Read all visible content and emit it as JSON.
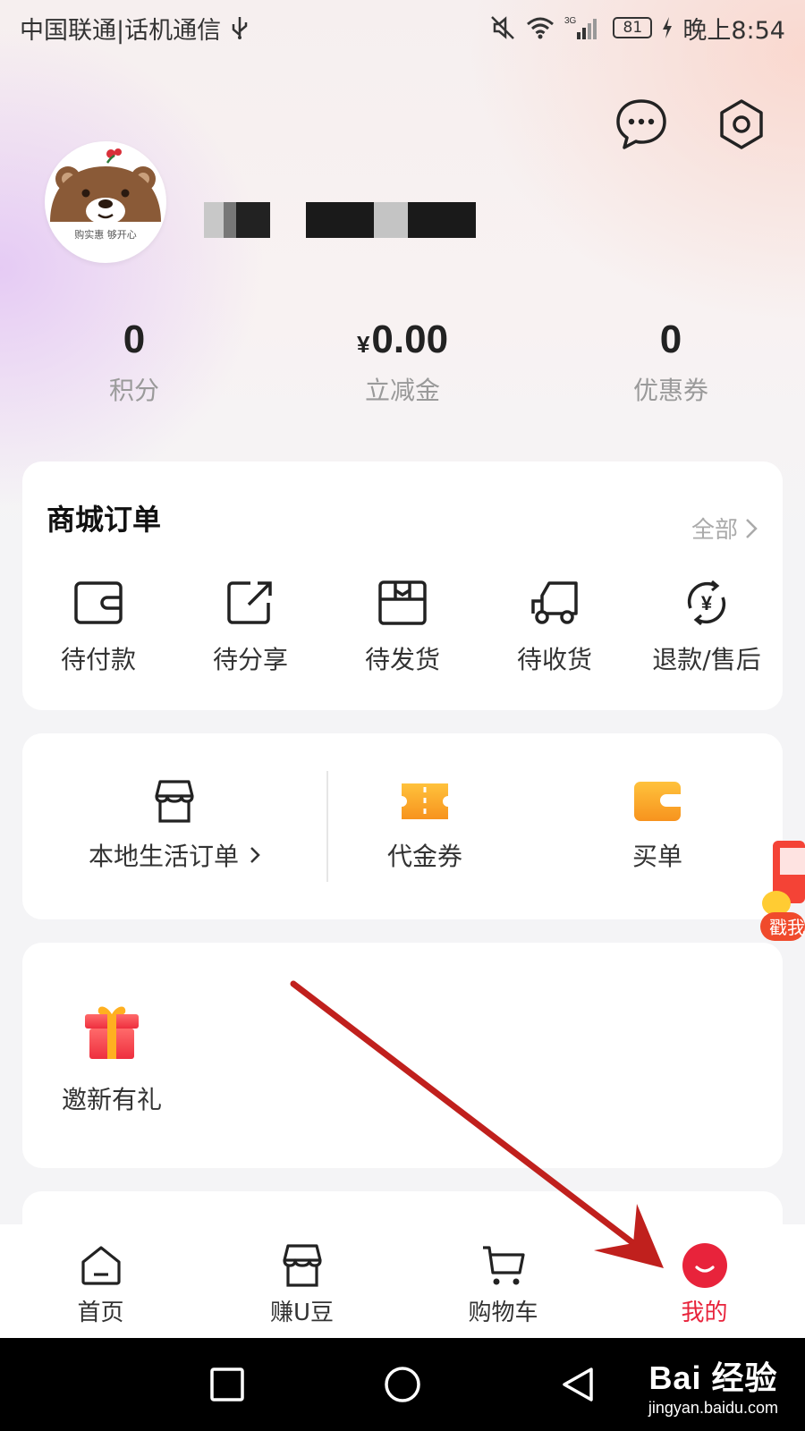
{
  "status_bar": {
    "carrier": "中国联通|话机通信",
    "battery": "81",
    "time": "晚上8:54",
    "network": "3G"
  },
  "profile": {
    "avatar_text": "购实惠 够开心",
    "username": "■■ ■■■■"
  },
  "stats": [
    {
      "value": "0",
      "label": "积分"
    },
    {
      "currency": "¥",
      "value": "0.00",
      "label": "立减金"
    },
    {
      "value": "0",
      "label": "优惠券"
    }
  ],
  "orders": {
    "title": "商城订单",
    "more": "全部",
    "items": [
      {
        "label": "待付款",
        "icon": "wallet-icon"
      },
      {
        "label": "待分享",
        "icon": "share-icon"
      },
      {
        "label": "待发货",
        "icon": "box-icon"
      },
      {
        "label": "待收货",
        "icon": "truck-icon"
      },
      {
        "label": "退款/售后",
        "icon": "refund-icon"
      }
    ]
  },
  "services": {
    "local_orders": "本地生活订单",
    "voucher": "代金券",
    "pay": "买单"
  },
  "invite": {
    "label": "邀新有礼"
  },
  "float_badge": "戳我",
  "tabbar": [
    {
      "label": "首页",
      "icon": "home-icon",
      "active": false
    },
    {
      "label": "赚U豆",
      "icon": "store-icon",
      "active": false
    },
    {
      "label": "购物车",
      "icon": "cart-icon",
      "active": false
    },
    {
      "label": "我的",
      "icon": "profile-smile-icon",
      "active": true
    }
  ],
  "colors": {
    "accent": "#e8233b",
    "orange": "#f7a31c",
    "annotation_arrow": "#c0201d"
  },
  "watermark": {
    "logo": "Bai 经验",
    "url": "jingyan.baidu.com"
  }
}
